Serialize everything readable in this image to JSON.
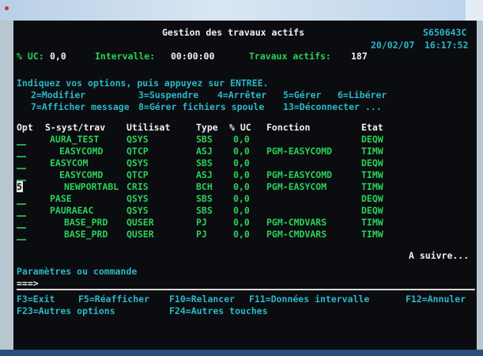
{
  "screen": {
    "title": "Gestion des travaux actifs",
    "system": "S650643C",
    "date": "20/02/07",
    "time": "16:17:52",
    "uc_label": "% UC:",
    "uc_value": "0,0",
    "interval_label": "Intervalle:",
    "interval_value": "00:00:00",
    "jobs_label": "Travaux actifs:",
    "jobs_value": "187",
    "instructions": "Indiquez vos options, puis appuyez sur ENTREE.",
    "options_line1": [
      "2=Modifier",
      "3=Suspendre",
      "4=Arrêter",
      "5=Gérer",
      "6=Libérer"
    ],
    "options_line2": [
      "7=Afficher message",
      "8=Gérer fichiers spoule",
      "13=Déconnecter ..."
    ],
    "columns": {
      "opt": "Opt",
      "subsys": "S-syst/trav",
      "user": "Utilisat",
      "type": "Type",
      "uc": "% UC",
      "function": "Fonction",
      "status": "Etat"
    },
    "rows": [
      {
        "opt": "",
        "subsys": "AURA_TEST",
        "user": "QSYS",
        "type": "SBS",
        "uc": "0,0",
        "function": "",
        "status": "DEQW"
      },
      {
        "opt": "",
        "subsys": "EASYCOMD",
        "user": "QTCP",
        "type": "ASJ",
        "uc": "0,0",
        "function": "PGM-EASYCOMD",
        "status": "TIMW"
      },
      {
        "opt": "",
        "subsys": "EASYCOM",
        "user": "QSYS",
        "type": "SBS",
        "uc": "0,0",
        "function": "",
        "status": "DEQW"
      },
      {
        "opt": "",
        "subsys": "EASYCOMD",
        "user": "QTCP",
        "type": "ASJ",
        "uc": "0,0",
        "function": "PGM-EASYCOMD",
        "status": "TIMW"
      },
      {
        "opt": "5",
        "subsys": "NEWPORTABL",
        "user": "CRIS",
        "type": "BCH",
        "uc": "0,0",
        "function": "PGM-EASYCOM",
        "status": "TIMW"
      },
      {
        "opt": "",
        "subsys": "PASE",
        "user": "QSYS",
        "type": "SBS",
        "uc": "0,0",
        "function": "",
        "status": "DEQW"
      },
      {
        "opt": "",
        "subsys": "PAURAEAC",
        "user": "QSYS",
        "type": "SBS",
        "uc": "0,0",
        "function": "",
        "status": "DEQW"
      },
      {
        "opt": "",
        "subsys": "BASE_PRD",
        "user": "QUSER",
        "type": "PJ",
        "uc": "0,0",
        "function": "PGM-CMDVARS",
        "status": "TIMW"
      },
      {
        "opt": "",
        "subsys": "BASE_PRD",
        "user": "QUSER",
        "type": "PJ",
        "uc": "0,0",
        "function": "PGM-CMDVARS",
        "status": "TIMW"
      }
    ],
    "more": "A suivre...",
    "params_label": "Paramètres ou commande",
    "prompt": "===>",
    "fkeys_line1": [
      "F3=Exit",
      "F5=Réafficher",
      "F10=Relancer",
      "F11=Données intervalle",
      "F12=Annuler"
    ],
    "fkeys_line2": [
      "F23=Autres options",
      "F24=Autres touches"
    ]
  },
  "colors": {
    "background": "#0b0c0f",
    "text_white": "#f1f1f1",
    "text_cyan": "#2bb8c6",
    "text_green": "#29d15a",
    "text_yellow": "#d8a84a"
  }
}
